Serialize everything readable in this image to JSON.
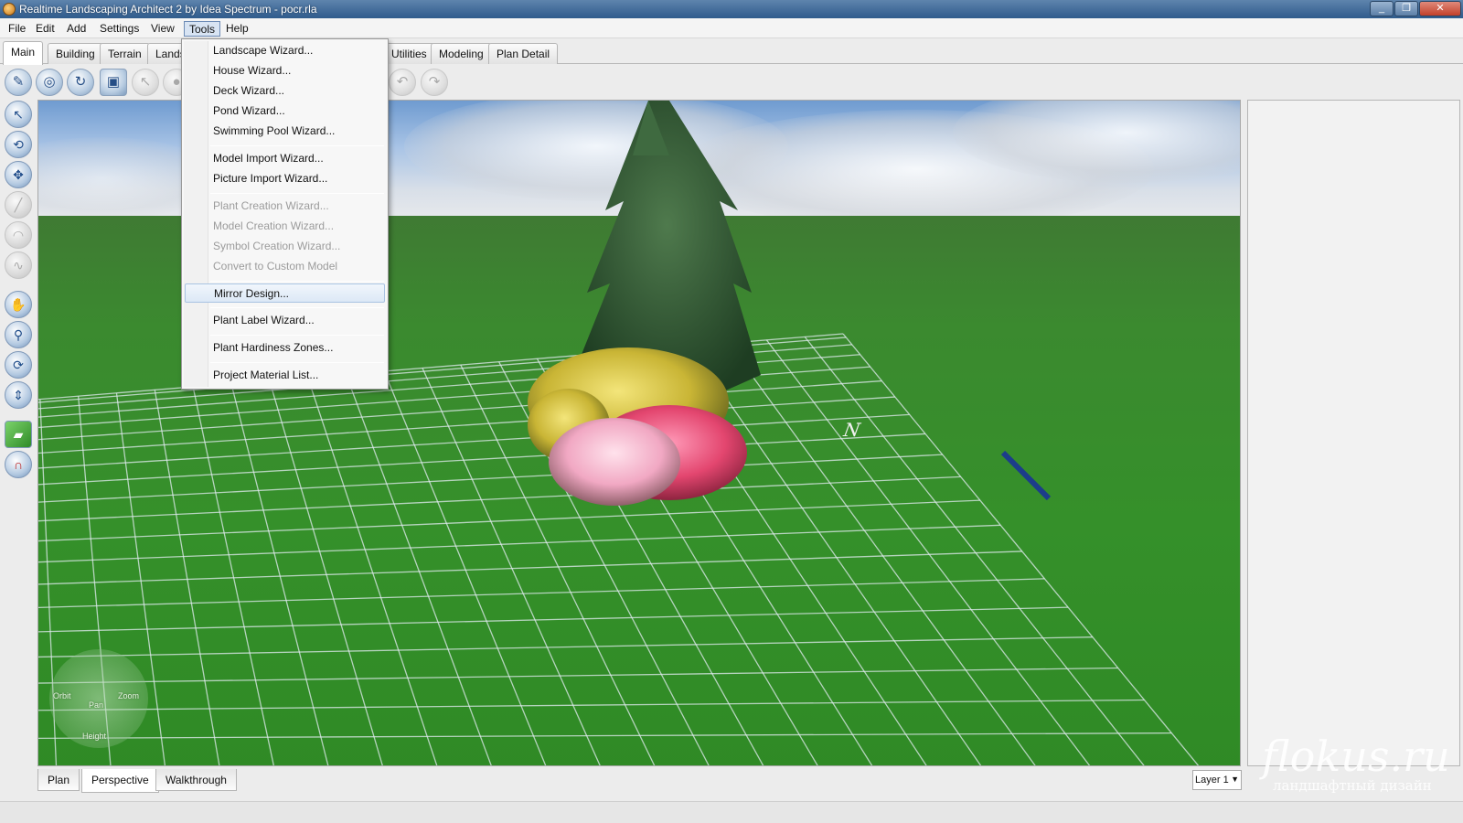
{
  "window": {
    "title": "Realtime Landscaping Architect 2 by Idea Spectrum - pocr.rla",
    "minimize_glyph": "_",
    "maximize_glyph": "❐",
    "close_glyph": "✕"
  },
  "menubar": {
    "items": [
      {
        "label": "File"
      },
      {
        "label": "Edit"
      },
      {
        "label": "Add"
      },
      {
        "label": "Settings"
      },
      {
        "label": "View"
      },
      {
        "label": "Tools"
      },
      {
        "label": "Help"
      }
    ],
    "active": "Tools"
  },
  "tabs": {
    "items": [
      {
        "label": "Main"
      },
      {
        "label": "Building"
      },
      {
        "label": "Terrain"
      },
      {
        "label": "Lands"
      },
      {
        "label": "Utilities"
      },
      {
        "label": "Modeling"
      },
      {
        "label": "Plan Detail"
      }
    ],
    "active": "Main"
  },
  "tools_menu": {
    "items": [
      {
        "label": "Landscape Wizard...",
        "enabled": true
      },
      {
        "label": "House Wizard...",
        "enabled": true
      },
      {
        "label": "Deck Wizard...",
        "enabled": true
      },
      {
        "label": "Pond Wizard...",
        "enabled": true
      },
      {
        "label": "Swimming Pool Wizard...",
        "enabled": true
      },
      {
        "label": "Model Import Wizard...",
        "enabled": true
      },
      {
        "label": "Picture Import Wizard...",
        "enabled": true
      },
      {
        "label": "Plant Creation Wizard...",
        "enabled": false
      },
      {
        "label": "Model Creation Wizard...",
        "enabled": false
      },
      {
        "label": "Symbol Creation Wizard...",
        "enabled": false
      },
      {
        "label": "Convert to Custom Model",
        "enabled": false
      },
      {
        "label": "Mirror Design...",
        "enabled": true,
        "highlighted": true
      },
      {
        "label": "Plant Label Wizard...",
        "enabled": true
      },
      {
        "label": "Plant Hardiness Zones...",
        "enabled": true
      },
      {
        "label": "Project Material List...",
        "enabled": true
      }
    ]
  },
  "navigation_widget": {
    "labels": {
      "orbit": "Orbit",
      "pan": "Pan",
      "zoom": "Zoom",
      "height": "Height"
    }
  },
  "view_tabs": {
    "items": [
      {
        "label": "Plan"
      },
      {
        "label": "Perspective"
      },
      {
        "label": "Walkthrough"
      }
    ],
    "active": "Perspective"
  },
  "layer": {
    "selected": "Layer 1"
  },
  "watermark": {
    "main": "flokus.ru",
    "sub": "ландшафтный дизайн"
  },
  "icons": {
    "toolbar": [
      "new-icon",
      "open-icon",
      "recent-icon",
      "save-icon",
      "pointer-icon",
      "edit-icon",
      "undo-icon",
      "redo-icon"
    ],
    "left_tools": [
      "select-icon",
      "rotate-icon",
      "move-icon",
      "draw-icon",
      "arc-icon",
      "curve-icon",
      "hand-icon",
      "zoom-icon",
      "orbit-icon",
      "height-icon",
      "terrain-icon",
      "magnet-icon"
    ]
  },
  "colors": {
    "sky_top": "#6f9bd0",
    "grass": "#358f2a",
    "menu_highlight": "#dce8f6",
    "title_bar": "#2f5b8c"
  }
}
